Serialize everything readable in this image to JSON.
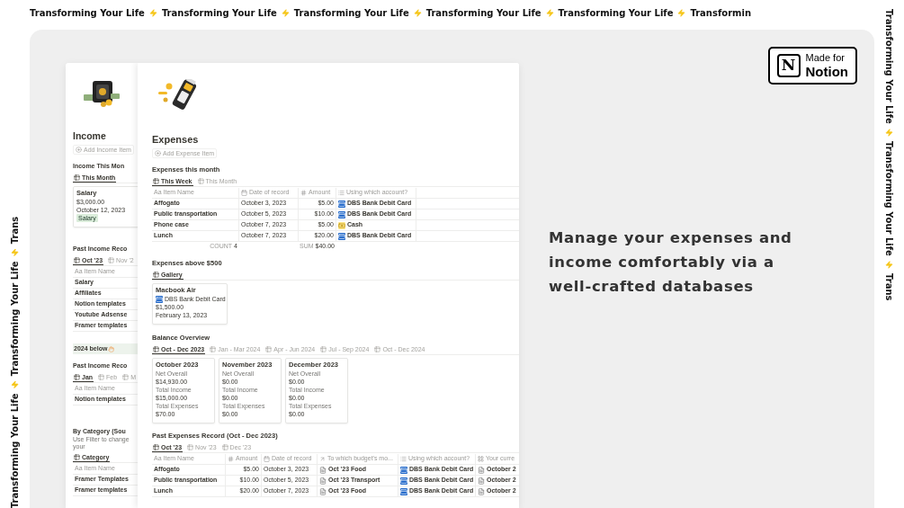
{
  "marquee": {
    "top": [
      "Transforming Your Life",
      "Transforming Your Life",
      "Transforming Your Life",
      "Transforming Your Life",
      "Transforming Your Life",
      "Transformin"
    ],
    "left": [
      "Transforming Your Life",
      "Transforming Your Life",
      "Trans"
    ],
    "right": [
      "Transforming Your Life",
      "Transforming Your Life",
      "Trans"
    ]
  },
  "badge": {
    "logo": "N",
    "line1": "Made for",
    "line2": "Notion"
  },
  "headline": [
    "Manage your expenses and",
    "income comfortably via a",
    "well-crafted databases"
  ],
  "income": {
    "title": "Income",
    "add_button": "Add Income Item",
    "sections": [
      {
        "kind": "gallery",
        "heading": "Income This Mon",
        "tabs": [
          {
            "label": "This Month",
            "selected": true
          }
        ],
        "cards": [
          {
            "title": "Salary",
            "lines": [
              "$3,000.00",
              "October 12, 2023"
            ],
            "tag": {
              "text": "Salary",
              "color": "#dbeddb"
            }
          }
        ]
      },
      {
        "kind": "table",
        "heading": "Past Income Reco",
        "tabs": [
          {
            "label": "Oct '23",
            "selected": true
          },
          {
            "label": "Nov '2",
            "selected": false
          }
        ],
        "columns": [
          {
            "kind": "title",
            "glyph": "Aa",
            "label": "Item Name"
          }
        ],
        "rows": [
          [
            "Salary"
          ],
          [
            "Affiliates"
          ],
          [
            "Notion templates"
          ],
          [
            "Youtube Adsense"
          ],
          [
            "Framer templates"
          ]
        ]
      },
      {
        "kind": "callout",
        "text": "2024 below"
      },
      {
        "kind": "table",
        "heading": "Past Income Reco",
        "tabs": [
          {
            "label": "Jan",
            "selected": true
          },
          {
            "label": "Feb",
            "selected": false
          },
          {
            "label": "M",
            "selected": false
          }
        ],
        "columns": [
          {
            "kind": "title",
            "glyph": "Aa",
            "label": "Item Name"
          }
        ],
        "rows": [
          [
            "Notion templates"
          ]
        ]
      },
      {
        "kind": "table",
        "heading": "By Category (Sou",
        "note": "Use Filter to change your",
        "tabs": [
          {
            "label": "Category",
            "selected": true
          }
        ],
        "columns": [
          {
            "kind": "title",
            "glyph": "Aa",
            "label": "Item Name"
          }
        ],
        "rows": [
          [
            "Framer Templates"
          ],
          [
            "Framer templates"
          ]
        ]
      }
    ]
  },
  "expenses": {
    "title": "Expenses",
    "add_button": "Add Expense Item",
    "sections": [
      {
        "kind": "table",
        "heading": "Expenses this month",
        "tabs": [
          {
            "label": "This Week",
            "selected": true
          },
          {
            "label": "This Month",
            "selected": false
          }
        ],
        "columns": [
          {
            "kind": "title",
            "glyph": "Aa",
            "label": "Item Name"
          },
          {
            "kind": "date",
            "label": "Date of record"
          },
          {
            "kind": "number",
            "label": "Amount"
          },
          {
            "kind": "select",
            "label": "Using which account?"
          }
        ],
        "footer": [
          {
            "kind": "count",
            "label": "COUNT",
            "value": "4"
          },
          {
            "kind": "sum",
            "label": "SUM",
            "value": "$40.00"
          }
        ],
        "rows": [
          [
            "Affogato",
            "October 3, 2023",
            "$5.00",
            {
              "text": "DBS Bank Debit Card",
              "kind": "card"
            }
          ],
          [
            "Public transportation",
            "October 5, 2023",
            "$10.00",
            {
              "text": "DBS Bank Debit Card",
              "kind": "card"
            }
          ],
          [
            "Phone case",
            "October 7, 2023",
            "$5.00",
            {
              "text": "Cash",
              "kind": "cash"
            }
          ],
          [
            "Lunch",
            "October 7, 2023",
            "$20.00",
            {
              "text": "DBS Bank Debit Card",
              "kind": "card"
            }
          ]
        ]
      },
      {
        "kind": "gallery",
        "heading": "Expenses above $500",
        "tabs": [
          {
            "label": "Gallery",
            "selected": true
          }
        ],
        "cards": [
          {
            "title": "Macbook Air",
            "lines": [
              {
                "text": "DBS Bank Debit Card",
                "kind": "card"
              },
              "$1,500.00",
              "February 13, 2023"
            ]
          }
        ]
      },
      {
        "kind": "gallery",
        "heading": "Balance Overview",
        "tabs": [
          {
            "label": "Oct - Dec 2023",
            "selected": true
          },
          {
            "label": "Jan - Mar 2024",
            "selected": false
          },
          {
            "label": "Apr - Jun 2024",
            "selected": false
          },
          {
            "label": "Jul - Sep 2024",
            "selected": false
          },
          {
            "label": "Oct - Dec 2024",
            "selected": false
          }
        ],
        "cards": [
          {
            "title": "October 2023",
            "fields": [
              {
                "label": "Net Overall",
                "value": "$14,930.00"
              },
              {
                "label": "Total Income",
                "value": "$15,000.00"
              },
              {
                "label": "Total Expenses",
                "value": "$70.00"
              }
            ]
          },
          {
            "title": "November 2023",
            "fields": [
              {
                "label": "Net Overall",
                "value": "$0.00"
              },
              {
                "label": "Total Income",
                "value": "$0.00"
              },
              {
                "label": "Total Expenses",
                "value": "$0.00"
              }
            ]
          },
          {
            "title": "December 2023",
            "fields": [
              {
                "label": "Net Overall",
                "value": "$0.00"
              },
              {
                "label": "Total Income",
                "value": "$0.00"
              },
              {
                "label": "Total Expenses",
                "value": "$0.00"
              }
            ]
          }
        ]
      },
      {
        "kind": "table",
        "heading": "Past Expenses Record (Oct - Dec 2023)",
        "tabs": [
          {
            "label": "Oct '23",
            "selected": true
          },
          {
            "label": "Nov '23",
            "selected": false
          },
          {
            "label": "Dec '23",
            "selected": false
          }
        ],
        "columns": [
          {
            "kind": "title",
            "glyph": "Aa",
            "label": "Item Name"
          },
          {
            "kind": "number",
            "label": "Amount"
          },
          {
            "kind": "date",
            "label": "Date of record"
          },
          {
            "kind": "relation",
            "label": "To which budget's mo..."
          },
          {
            "kind": "select",
            "label": "Using which account?"
          },
          {
            "kind": "rollup",
            "label": "Your curre"
          }
        ],
        "rows": [
          [
            "Affogato",
            "$5.00",
            "October 3, 2023",
            {
              "text": "Oct '23 Food",
              "kind": "page"
            },
            {
              "text": "DBS Bank Debit Card",
              "kind": "card"
            },
            {
              "text": "October 2",
              "kind": "page"
            }
          ],
          [
            "Public transportation",
            "$10.00",
            "October 5, 2023",
            {
              "text": "Oct '23 Transport",
              "kind": "page"
            },
            {
              "text": "DBS Bank Debit Card",
              "kind": "card"
            },
            {
              "text": "October 2",
              "kind": "page"
            }
          ],
          [
            "Lunch",
            "$20.00",
            "October 7, 2023",
            {
              "text": "Oct '23 Food",
              "kind": "page"
            },
            {
              "text": "DBS Bank Debit Card",
              "kind": "card"
            },
            {
              "text": "October 2",
              "kind": "page"
            }
          ]
        ]
      }
    ]
  }
}
